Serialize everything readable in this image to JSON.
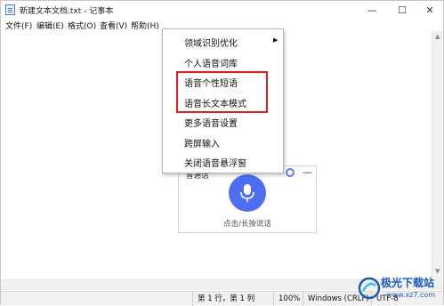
{
  "window": {
    "title": "新建文本文档.txt - 记事本",
    "controls": {
      "minimize": "—",
      "maximize": "☐",
      "close": "✕"
    }
  },
  "menubar": {
    "items": [
      "文件(F)",
      "编辑(E)",
      "格式(O)",
      "查看(V)",
      "帮助(H)"
    ]
  },
  "context_menu": {
    "items": [
      "领域识别优化",
      "个人语音词库",
      "语音个性短语",
      "语音长文本模式",
      "更多语音设置",
      "跨屏输入",
      "关闭语音悬浮窗"
    ],
    "submenu_arrow": "▶"
  },
  "voice_panel": {
    "title": "普通话",
    "minimize": "—",
    "hint": "点击/长按说话"
  },
  "statusbar": {
    "position": "第 1 行，第 1 列",
    "zoom": "100%",
    "line_ending": "Windows (CRLF)",
    "encoding": "UTF-8"
  },
  "watermark": {
    "name": "极光下载站",
    "url": "www.xz7.com"
  },
  "colors": {
    "highlight": "#e02020",
    "mic_button": "#4e6ef2",
    "watermark": "#1a5fb4"
  }
}
